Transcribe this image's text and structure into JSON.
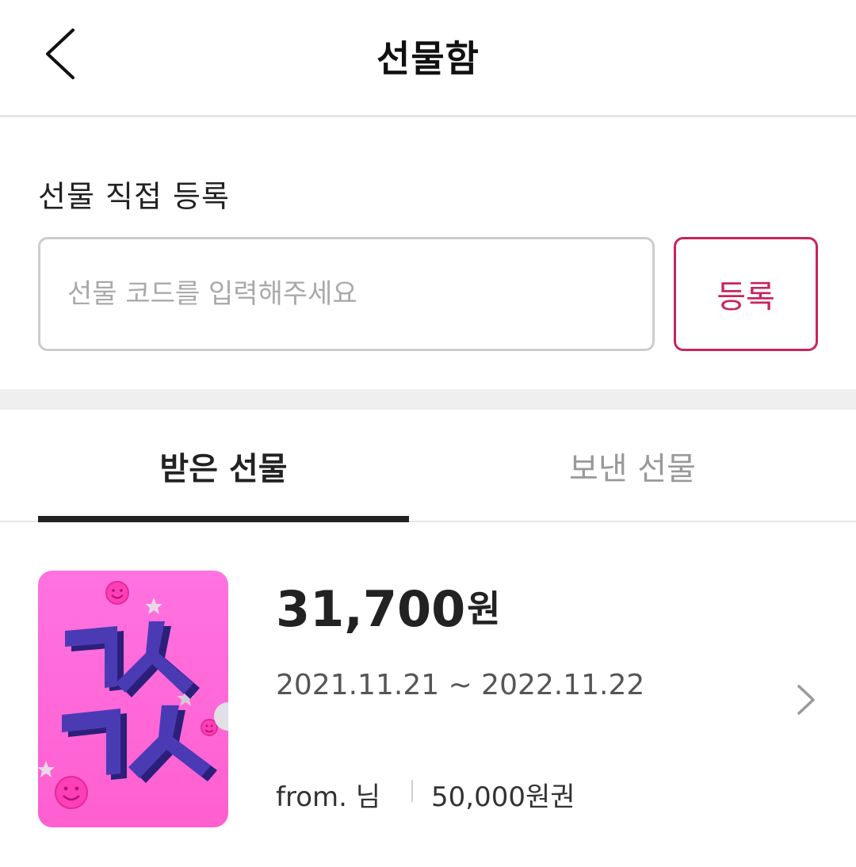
{
  "header": {
    "title": "선물함",
    "back_icon": "chevron-left-icon"
  },
  "register": {
    "title": "선물 직접 등록",
    "input_placeholder": "선물 코드를 입력해주세요",
    "input_value": "",
    "button_label": "등록",
    "accent_color": "#c8245e"
  },
  "tabs": [
    {
      "label": "받은 선물",
      "selected": true
    },
    {
      "label": "보낸 선물",
      "selected": false
    }
  ],
  "gifts": [
    {
      "amount": "31,700",
      "currency": "원",
      "period": "2021.11.21 ~ 2022.11.22",
      "from": "from. 님",
      "voucher": "50,000원권",
      "thumbnail_text": "ㄱㅅ ㄱㅅ",
      "thumbnail_color": "#ff6fd8",
      "chevron_icon": "chevron-right-icon"
    }
  ]
}
